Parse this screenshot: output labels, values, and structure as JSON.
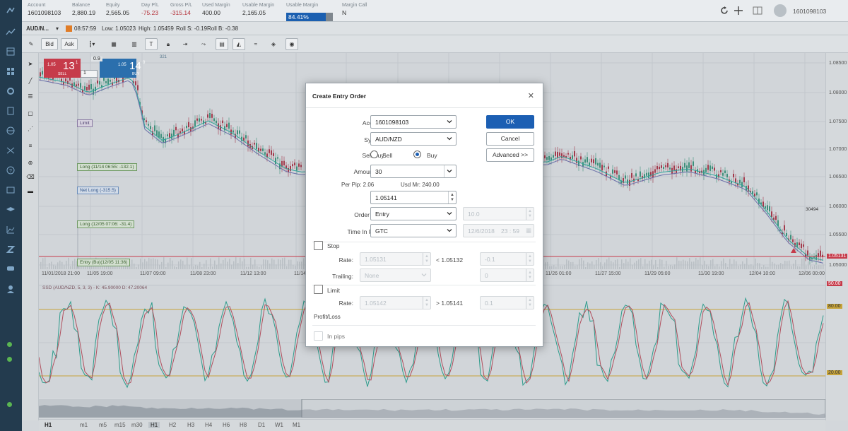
{
  "account_bar": {
    "fields": [
      {
        "label": "Account",
        "value": "1601098103"
      },
      {
        "label": "Balance",
        "value": "2,880.19"
      },
      {
        "label": "Equity",
        "value": "2,565.05"
      },
      {
        "label": "Day P/L",
        "value": "-75.23"
      },
      {
        "label": "Gross P/L",
        "value": "-315.14"
      },
      {
        "label": "Used Margin",
        "value": "400.00"
      },
      {
        "label": "Usable Margin",
        "value": "2,165.05"
      },
      {
        "label": "Usable Margin",
        "value": "84.41%"
      },
      {
        "label": "Margin Call",
        "value": "N"
      }
    ],
    "usable_margin_fraction": 0.8441,
    "username": "1601098103"
  },
  "instrument_row": {
    "symbol": "AUD/N...",
    "time": "08:57:59",
    "low": "Low: 1.05023",
    "high": "High: 1.05459",
    "roll_s": "Roll S: -0.19",
    "roll_b": "Roll B: -0.38"
  },
  "toolbar": {
    "bid_label": "Bid",
    "ask_label": "Ask"
  },
  "quote_widget": {
    "sell_small": "1.05",
    "sell_big": "13",
    "sell_sup": "1",
    "sell_label": "SELL",
    "buy_small": "1.05",
    "buy_big": "14",
    "buy_sup": "0",
    "buy_label": "BUY",
    "spread": "0.9",
    "amount": "1",
    "high_tag": "321"
  },
  "chart": {
    "y_ticks": [
      "1.08500",
      "1.08000",
      "1.07500",
      "1.07000",
      "1.06500",
      "1.06000",
      "1.05500",
      "1.05000"
    ],
    "x_ticks": [
      "11/01/2018 21:00",
      "11/05 19:00",
      "11/07 09:00",
      "11/08 23:00",
      "11/12 13:00",
      "11/14",
      "11/26 01:00",
      "11/27 15:00",
      "11/29 05:00",
      "11/30 19:00",
      "12/04 10:00",
      "12/06 00:00"
    ],
    "order_labels": [
      "Limit",
      "Long (11/14 06:55: -132.1)",
      "Net Long (-315.5)",
      "Long (12/05 07:06: -31.4)",
      "Entry (Bu)(12/05 11:36)"
    ],
    "crosshair_value": "30494",
    "price_tag": "1.05131",
    "indicator_title": "SSD (AUD/NZD, 5, 3, 3) - K: 45.90000 D: 47.20064",
    "indicator_levels": [
      "80.00",
      "20.00"
    ],
    "indicator_tag": "50.00"
  },
  "timeframes": [
    "H1",
    "m1",
    "m5",
    "m15",
    "m30",
    "H1",
    "H2",
    "H3",
    "H4",
    "H6",
    "H8",
    "D1",
    "W1",
    "M1"
  ],
  "dialog": {
    "title": "Create Entry Order",
    "account_label": "Account:",
    "account_value": "1601098103",
    "symbol_label": "Symbol:",
    "symbol_value": "AUD/NZD",
    "sellbuy_label": "Sell/Buy:",
    "sell_option": "Sell",
    "buy_option": "Buy",
    "amount_label": "Amount (K):",
    "amount_value": "30",
    "per_pip": "Per Pip: 2.06",
    "usd_mr": "Usd Mr: 240.00",
    "rate_label": "Rate:",
    "rate_value": "1.05141",
    "order_type_label": "Order Type:",
    "order_type_value": "Entry",
    "order_type_extra": "10.0",
    "tif_label": "Time In Force:",
    "tif_value": "GTC",
    "tif_date": "12/6/2018",
    "tif_time": "23 : 59",
    "ok_label": "OK",
    "cancel_label": "Cancel",
    "advanced_label": "Advanced >>",
    "stop_label": "Stop",
    "stop_rate_label": "Rate:",
    "stop_rate_value": "1.05131",
    "stop_condition": "< 1.05132",
    "stop_pips": "-0.1",
    "trailing_label": "Trailing:",
    "trailing_value": "None",
    "trailing_pips": "0",
    "limit_label": "Limit",
    "limit_rate_label": "Rate:",
    "limit_rate_value": "1.05142",
    "limit_condition": "> 1.05141",
    "limit_pips": "0.1",
    "profit_loss_label": "Profit/Loss",
    "in_pips_label": "In pips"
  }
}
